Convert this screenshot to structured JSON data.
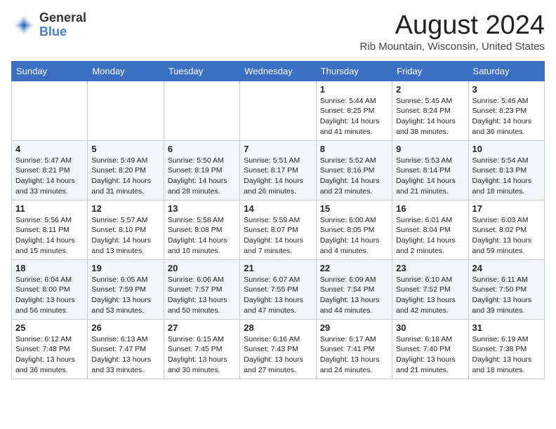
{
  "header": {
    "logo_line1": "General",
    "logo_line2": "Blue",
    "month_title": "August 2024",
    "location": "Rib Mountain, Wisconsin, United States"
  },
  "days_of_week": [
    "Sunday",
    "Monday",
    "Tuesday",
    "Wednesday",
    "Thursday",
    "Friday",
    "Saturday"
  ],
  "weeks": [
    [
      {
        "day": "",
        "content": ""
      },
      {
        "day": "",
        "content": ""
      },
      {
        "day": "",
        "content": ""
      },
      {
        "day": "",
        "content": ""
      },
      {
        "day": "1",
        "content": "Sunrise: 5:44 AM\nSunset: 8:25 PM\nDaylight: 14 hours\nand 41 minutes."
      },
      {
        "day": "2",
        "content": "Sunrise: 5:45 AM\nSunset: 8:24 PM\nDaylight: 14 hours\nand 38 minutes."
      },
      {
        "day": "3",
        "content": "Sunrise: 5:46 AM\nSunset: 8:23 PM\nDaylight: 14 hours\nand 36 minutes."
      }
    ],
    [
      {
        "day": "4",
        "content": "Sunrise: 5:47 AM\nSunset: 8:21 PM\nDaylight: 14 hours\nand 33 minutes."
      },
      {
        "day": "5",
        "content": "Sunrise: 5:49 AM\nSunset: 8:20 PM\nDaylight: 14 hours\nand 31 minutes."
      },
      {
        "day": "6",
        "content": "Sunrise: 5:50 AM\nSunset: 8:19 PM\nDaylight: 14 hours\nand 28 minutes."
      },
      {
        "day": "7",
        "content": "Sunrise: 5:51 AM\nSunset: 8:17 PM\nDaylight: 14 hours\nand 26 minutes."
      },
      {
        "day": "8",
        "content": "Sunrise: 5:52 AM\nSunset: 8:16 PM\nDaylight: 14 hours\nand 23 minutes."
      },
      {
        "day": "9",
        "content": "Sunrise: 5:53 AM\nSunset: 8:14 PM\nDaylight: 14 hours\nand 21 minutes."
      },
      {
        "day": "10",
        "content": "Sunrise: 5:54 AM\nSunset: 8:13 PM\nDaylight: 14 hours\nand 18 minutes."
      }
    ],
    [
      {
        "day": "11",
        "content": "Sunrise: 5:56 AM\nSunset: 8:11 PM\nDaylight: 14 hours\nand 15 minutes."
      },
      {
        "day": "12",
        "content": "Sunrise: 5:57 AM\nSunset: 8:10 PM\nDaylight: 14 hours\nand 13 minutes."
      },
      {
        "day": "13",
        "content": "Sunrise: 5:58 AM\nSunset: 8:08 PM\nDaylight: 14 hours\nand 10 minutes."
      },
      {
        "day": "14",
        "content": "Sunrise: 5:59 AM\nSunset: 8:07 PM\nDaylight: 14 hours\nand 7 minutes."
      },
      {
        "day": "15",
        "content": "Sunrise: 6:00 AM\nSunset: 8:05 PM\nDaylight: 14 hours\nand 4 minutes."
      },
      {
        "day": "16",
        "content": "Sunrise: 6:01 AM\nSunset: 8:04 PM\nDaylight: 14 hours\nand 2 minutes."
      },
      {
        "day": "17",
        "content": "Sunrise: 6:03 AM\nSunset: 8:02 PM\nDaylight: 13 hours\nand 59 minutes."
      }
    ],
    [
      {
        "day": "18",
        "content": "Sunrise: 6:04 AM\nSunset: 8:00 PM\nDaylight: 13 hours\nand 56 minutes."
      },
      {
        "day": "19",
        "content": "Sunrise: 6:05 AM\nSunset: 7:59 PM\nDaylight: 13 hours\nand 53 minutes."
      },
      {
        "day": "20",
        "content": "Sunrise: 6:06 AM\nSunset: 7:57 PM\nDaylight: 13 hours\nand 50 minutes."
      },
      {
        "day": "21",
        "content": "Sunrise: 6:07 AM\nSunset: 7:55 PM\nDaylight: 13 hours\nand 47 minutes."
      },
      {
        "day": "22",
        "content": "Sunrise: 6:09 AM\nSunset: 7:54 PM\nDaylight: 13 hours\nand 44 minutes."
      },
      {
        "day": "23",
        "content": "Sunrise: 6:10 AM\nSunset: 7:52 PM\nDaylight: 13 hours\nand 42 minutes."
      },
      {
        "day": "24",
        "content": "Sunrise: 6:11 AM\nSunset: 7:50 PM\nDaylight: 13 hours\nand 39 minutes."
      }
    ],
    [
      {
        "day": "25",
        "content": "Sunrise: 6:12 AM\nSunset: 7:48 PM\nDaylight: 13 hours\nand 36 minutes."
      },
      {
        "day": "26",
        "content": "Sunrise: 6:13 AM\nSunset: 7:47 PM\nDaylight: 13 hours\nand 33 minutes."
      },
      {
        "day": "27",
        "content": "Sunrise: 6:15 AM\nSunset: 7:45 PM\nDaylight: 13 hours\nand 30 minutes."
      },
      {
        "day": "28",
        "content": "Sunrise: 6:16 AM\nSunset: 7:43 PM\nDaylight: 13 hours\nand 27 minutes."
      },
      {
        "day": "29",
        "content": "Sunrise: 6:17 AM\nSunset: 7:41 PM\nDaylight: 13 hours\nand 24 minutes."
      },
      {
        "day": "30",
        "content": "Sunrise: 6:18 AM\nSunset: 7:40 PM\nDaylight: 13 hours\nand 21 minutes."
      },
      {
        "day": "31",
        "content": "Sunrise: 6:19 AM\nSunset: 7:38 PM\nDaylight: 13 hours\nand 18 minutes."
      }
    ]
  ]
}
